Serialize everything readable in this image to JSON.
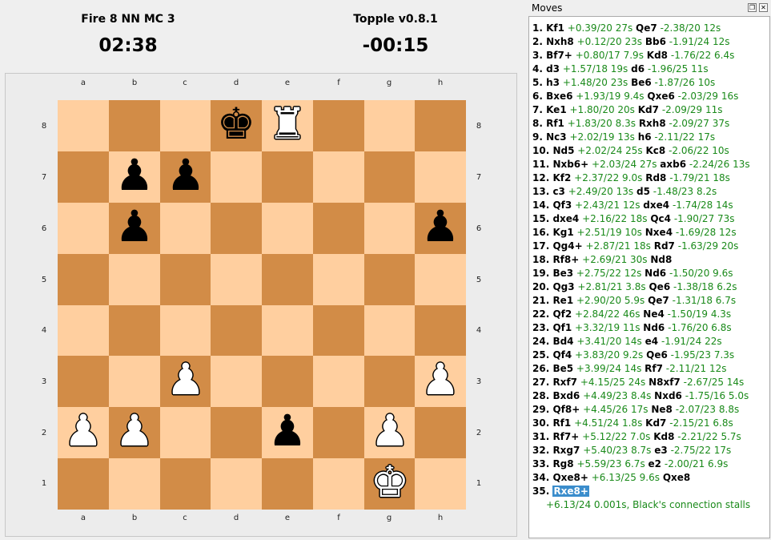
{
  "players": {
    "white": {
      "name": "Fire 8 NN MC 3",
      "clock": "02:38"
    },
    "black": {
      "name": "Topple v0.8.1",
      "clock": "-00:15"
    }
  },
  "board": {
    "files": [
      "a",
      "b",
      "c",
      "d",
      "e",
      "f",
      "g",
      "h"
    ],
    "ranks": [
      "8",
      "7",
      "6",
      "5",
      "4",
      "3",
      "2",
      "1"
    ],
    "pieces": [
      {
        "square": "d8",
        "type": "king",
        "color": "black"
      },
      {
        "square": "e8",
        "type": "rook",
        "color": "white"
      },
      {
        "square": "b7",
        "type": "pawn",
        "color": "black"
      },
      {
        "square": "c7",
        "type": "pawn",
        "color": "black"
      },
      {
        "square": "b6",
        "type": "pawn",
        "color": "black"
      },
      {
        "square": "h6",
        "type": "pawn",
        "color": "black"
      },
      {
        "square": "c3",
        "type": "pawn",
        "color": "white"
      },
      {
        "square": "h3",
        "type": "pawn",
        "color": "white"
      },
      {
        "square": "a2",
        "type": "pawn",
        "color": "white"
      },
      {
        "square": "b2",
        "type": "pawn",
        "color": "white"
      },
      {
        "square": "e2",
        "type": "pawn",
        "color": "black"
      },
      {
        "square": "g2",
        "type": "pawn",
        "color": "white"
      },
      {
        "square": "g1",
        "type": "king",
        "color": "white"
      }
    ],
    "colors": {
      "light": "#ffcf9f",
      "dark": "#d28c47"
    }
  },
  "moves_panel": {
    "title": "Moves",
    "moves": [
      {
        "n": "1.",
        "w": "Kf1",
        "we": "+0.39/20 27s",
        "b": "Qe7",
        "be": "-2.38/20 12s"
      },
      {
        "n": "2.",
        "w": "Nxh8",
        "we": "+0.12/20 23s",
        "b": "Bb6",
        "be": "-1.91/24 12s"
      },
      {
        "n": "3.",
        "w": "Bf7+",
        "we": "+0.80/17 7.9s",
        "b": "Kd8",
        "be": "-1.76/22 6.4s"
      },
      {
        "n": "4.",
        "w": "d3",
        "we": "+1.57/18 19s",
        "b": "d6",
        "be": "-1.96/25 11s"
      },
      {
        "n": "5.",
        "w": "h3",
        "we": "+1.48/20 23s",
        "b": "Be6",
        "be": "-1.87/26 10s"
      },
      {
        "n": "6.",
        "w": "Bxe6",
        "we": "+1.93/19 9.4s",
        "b": "Qxe6",
        "be": "-2.03/29 16s"
      },
      {
        "n": "7.",
        "w": "Ke1",
        "we": "+1.80/20 20s",
        "b": "Kd7",
        "be": "-2.09/29 11s"
      },
      {
        "n": "8.",
        "w": "Rf1",
        "we": "+1.83/20 8.3s",
        "b": "Rxh8",
        "be": "-2.09/27 37s"
      },
      {
        "n": "9.",
        "w": "Nc3",
        "we": "+2.02/19 13s",
        "b": "h6",
        "be": "-2.11/22 17s"
      },
      {
        "n": "10.",
        "w": "Nd5",
        "we": "+2.02/24 25s",
        "b": "Kc8",
        "be": "-2.06/22 10s"
      },
      {
        "n": "11.",
        "w": "Nxb6+",
        "we": "+2.03/24 27s",
        "b": "axb6",
        "be": "-2.24/26 13s"
      },
      {
        "n": "12.",
        "w": "Kf2",
        "we": "+2.37/22 9.0s",
        "b": "Rd8",
        "be": "-1.79/21 18s"
      },
      {
        "n": "13.",
        "w": "c3",
        "we": "+2.49/20 13s",
        "b": "d5",
        "be": "-1.48/23 8.2s"
      },
      {
        "n": "14.",
        "w": "Qf3",
        "we": "+2.43/21 12s",
        "b": "dxe4",
        "be": "-1.74/28 14s"
      },
      {
        "n": "15.",
        "w": "dxe4",
        "we": "+2.16/22 18s",
        "b": "Qc4",
        "be": "-1.90/27 73s"
      },
      {
        "n": "16.",
        "w": "Kg1",
        "we": "+2.51/19 10s",
        "b": "Nxe4",
        "be": "-1.69/28 12s"
      },
      {
        "n": "17.",
        "w": "Qg4+",
        "we": "+2.87/21 18s",
        "b": "Rd7",
        "be": "-1.63/29 20s"
      },
      {
        "n": "18.",
        "w": "Rf8+",
        "we": "+2.69/21 30s",
        "b": "Nd8",
        "be": ""
      },
      {
        "n": "19.",
        "w": "Be3",
        "we": "+2.75/22 12s",
        "b": "Nd6",
        "be": "-1.50/20 9.6s"
      },
      {
        "n": "20.",
        "w": "Qg3",
        "we": "+2.81/21 3.8s",
        "b": "Qe6",
        "be": "-1.38/18 6.2s"
      },
      {
        "n": "21.",
        "w": "Re1",
        "we": "+2.90/20 5.9s",
        "b": "Qe7",
        "be": "-1.31/18 6.7s"
      },
      {
        "n": "22.",
        "w": "Qf2",
        "we": "+2.84/22 46s",
        "b": "Ne4",
        "be": "-1.50/19 4.3s"
      },
      {
        "n": "23.",
        "w": "Qf1",
        "we": "+3.32/19 11s",
        "b": "Nd6",
        "be": "-1.76/20 6.8s"
      },
      {
        "n": "24.",
        "w": "Bd4",
        "we": "+3.41/20 14s",
        "b": "e4",
        "be": "-1.91/24 22s"
      },
      {
        "n": "25.",
        "w": "Qf4",
        "we": "+3.83/20 9.2s",
        "b": "Qe6",
        "be": "-1.95/23 7.3s"
      },
      {
        "n": "26.",
        "w": "Be5",
        "we": "+3.99/24 14s",
        "b": "Rf7",
        "be": "-2.11/21 12s"
      },
      {
        "n": "27.",
        "w": "Rxf7",
        "we": "+4.15/25 24s",
        "b": "N8xf7",
        "be": "-2.67/25 14s"
      },
      {
        "n": "28.",
        "w": "Bxd6",
        "we": "+4.49/23 8.4s",
        "b": "Nxd6",
        "be": "-1.75/16 5.0s"
      },
      {
        "n": "29.",
        "w": "Qf8+",
        "we": "+4.45/26 17s",
        "b": "Ne8",
        "be": "-2.07/23 8.8s"
      },
      {
        "n": "30.",
        "w": "Rf1",
        "we": "+4.51/24 1.8s",
        "b": "Kd7",
        "be": "-2.15/21 6.8s"
      },
      {
        "n": "31.",
        "w": "Rf7+",
        "we": "+5.12/22 7.0s",
        "b": "Kd8",
        "be": "-2.21/22 5.7s"
      },
      {
        "n": "32.",
        "w": "Rxg7",
        "we": "+5.40/23 8.7s",
        "b": "e3",
        "be": "-2.75/22 17s"
      },
      {
        "n": "33.",
        "w": "Rg8",
        "we": "+5.59/23 6.7s",
        "b": "e2",
        "be": "-2.00/21 6.9s"
      },
      {
        "n": "34.",
        "w": "Qxe8+",
        "we": "+6.13/25 9.6s",
        "b": "Qxe8",
        "be": ""
      }
    ],
    "last_move": {
      "n": "35.",
      "w": "Rxe8+"
    },
    "last_comment": "+6.13/24 0.001s, Black's connection stalls"
  }
}
